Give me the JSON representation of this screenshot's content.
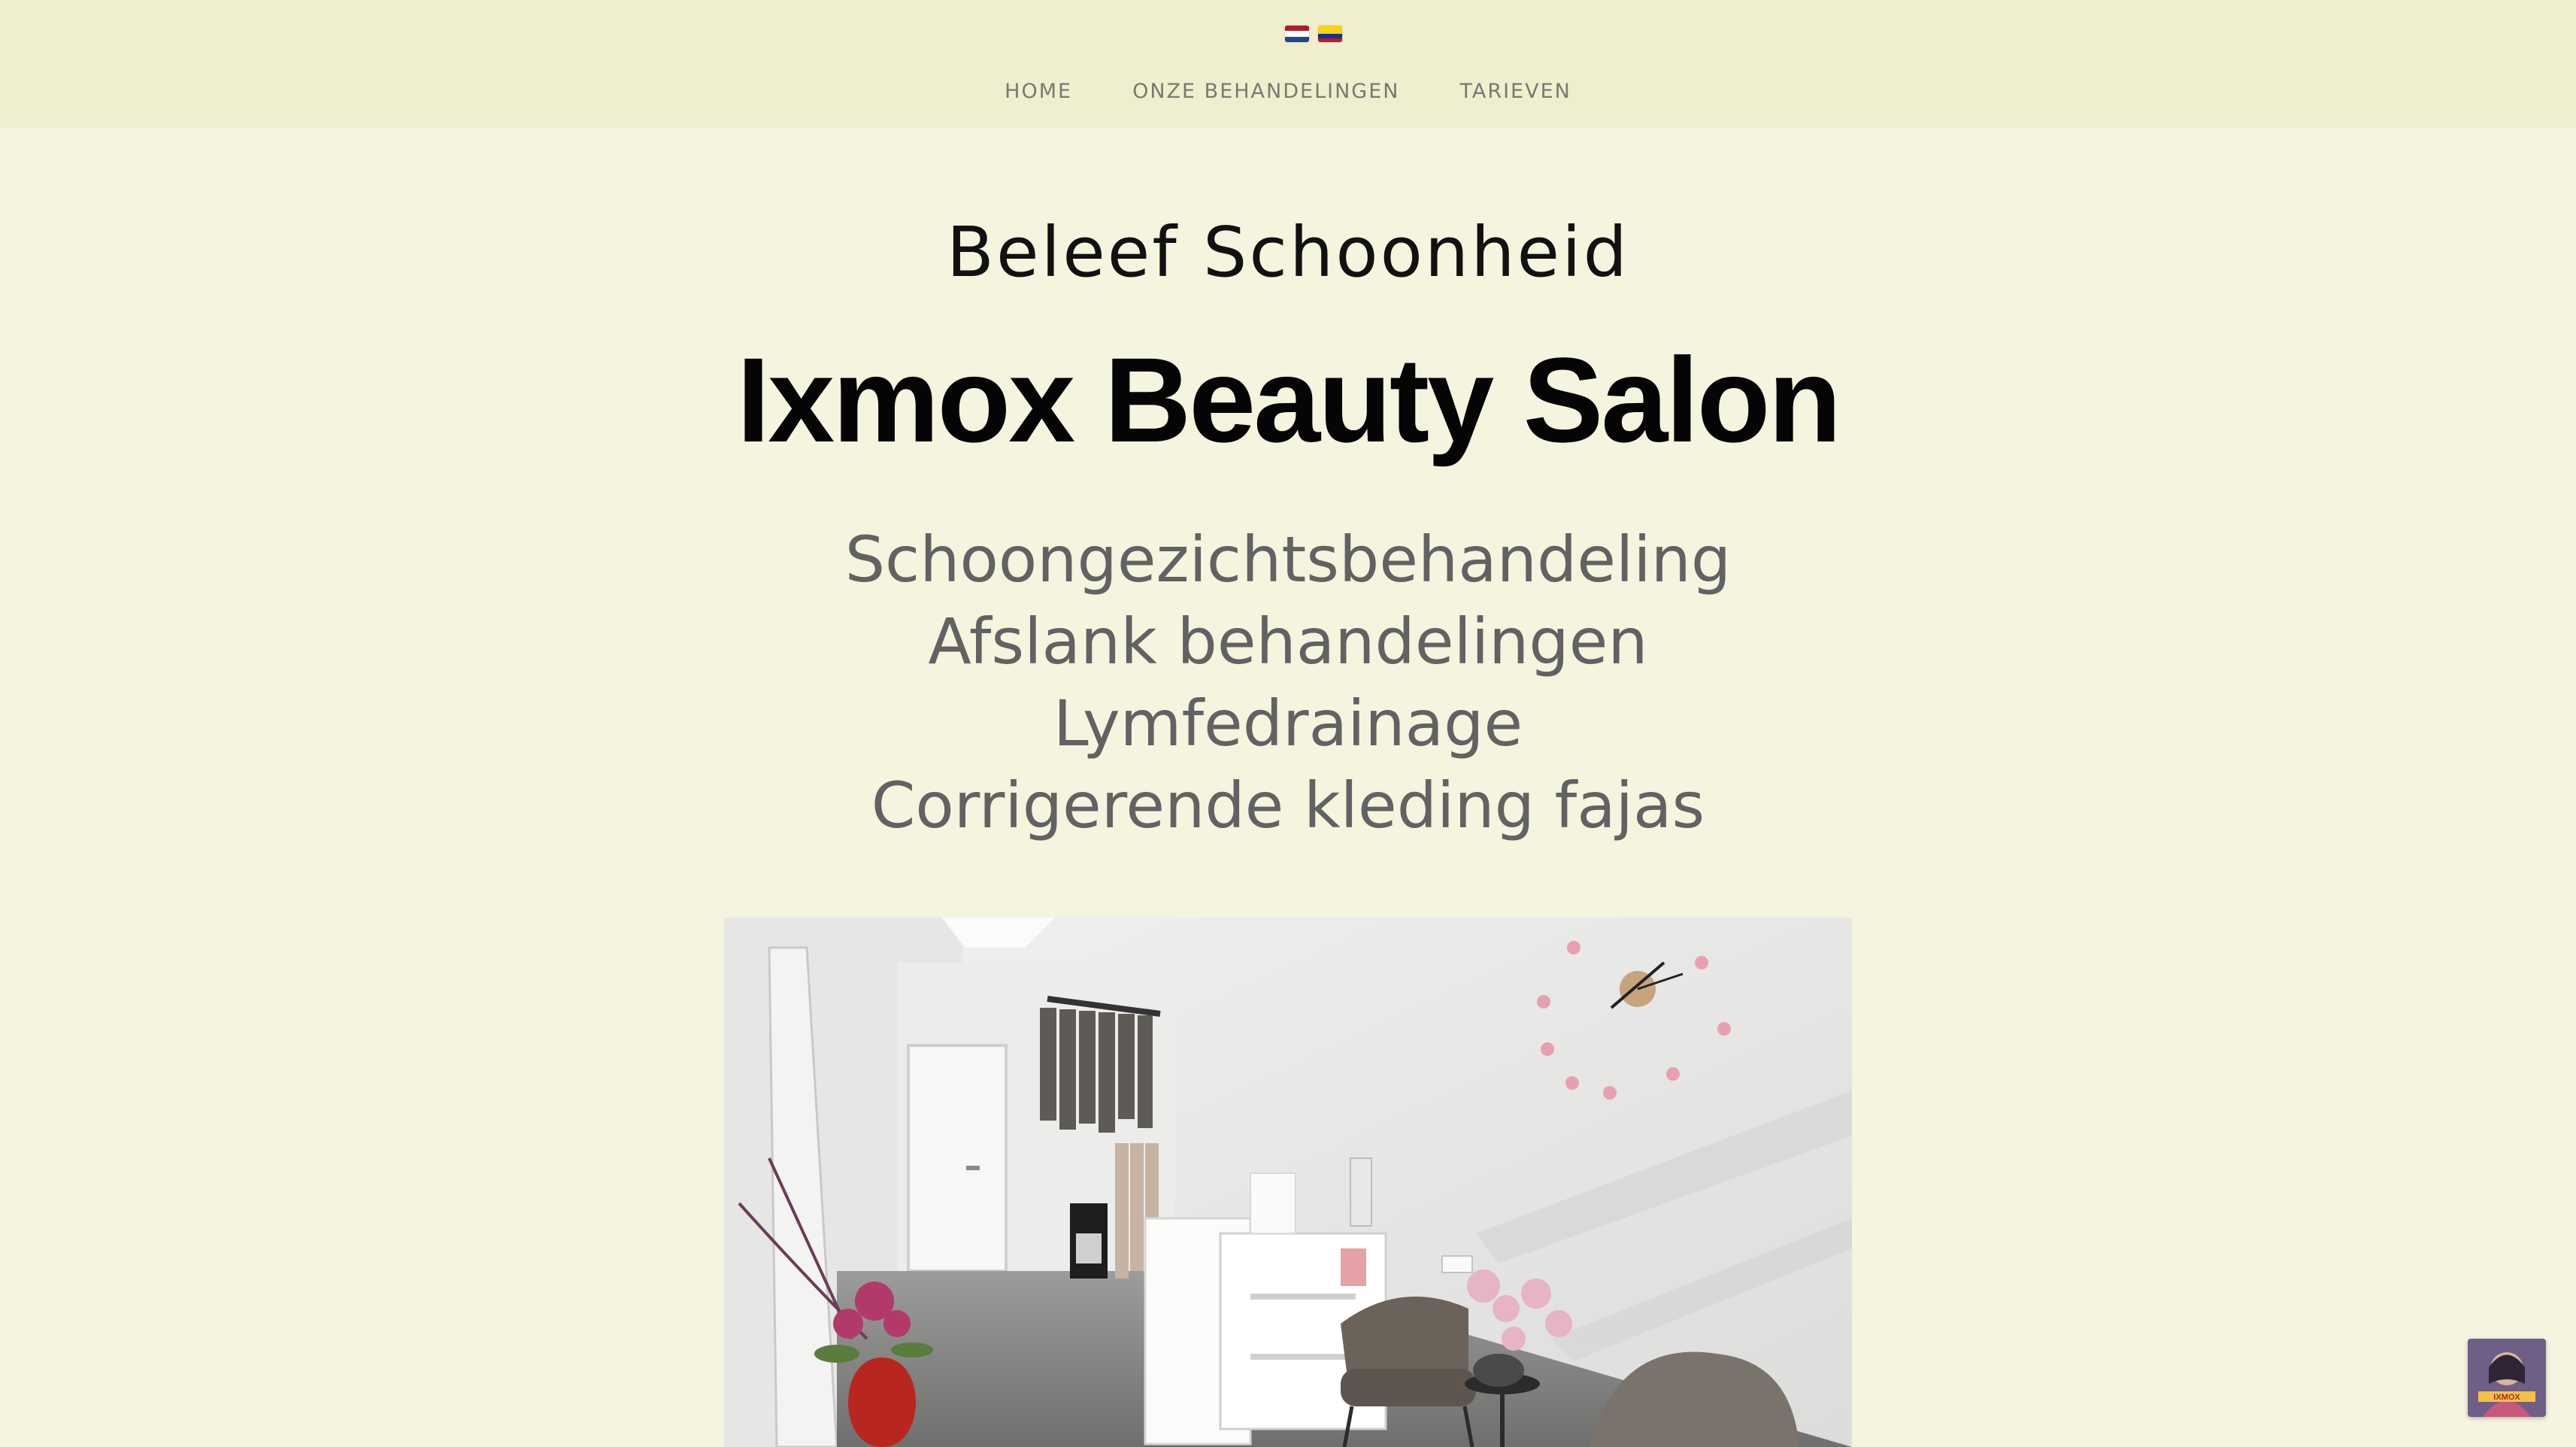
{
  "colors": {
    "header_bg": "#efefcf",
    "page_bg": "#f4f4df",
    "nav_text": "#777a70",
    "service_text": "#626262"
  },
  "flags": [
    {
      "name": "netherlands-flag-icon",
      "colors": [
        "#ae1c28",
        "#ffffff",
        "#21468b"
      ]
    },
    {
      "name": "colombia-flag-icon",
      "colors": [
        "#fcd116",
        "#003893",
        "#ce1126"
      ]
    }
  ],
  "nav": {
    "items": [
      {
        "label": "HOME"
      },
      {
        "label": "ONZE BEHANDELINGEN"
      },
      {
        "label": "TARIEVEN"
      }
    ]
  },
  "hero": {
    "tagline": "Beleef Schoonheid",
    "title": "Ixmox Beauty Salon",
    "services": [
      "Schoongezichtsbehandeling",
      "Afslank behandelingen",
      "Lymfedrainage",
      "Corrigerende kleding fajas"
    ]
  },
  "badge": {
    "logo_text": "IXMOX"
  }
}
